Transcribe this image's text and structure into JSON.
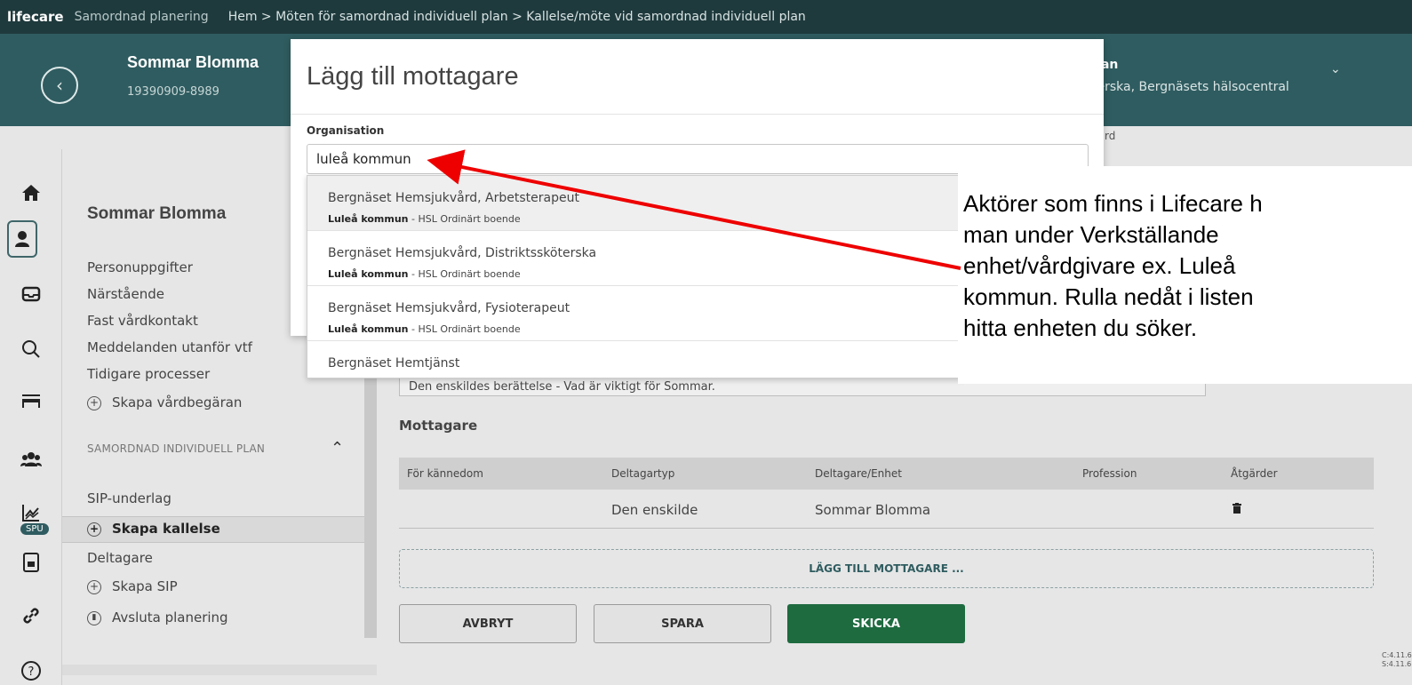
{
  "topbar": {
    "brand": "lifecare",
    "app_name": "Samordnad planering",
    "breadcrumb": "Hem > Möten för samordnad individuell plan > Kallelse/möte vid samordnad individuell plan"
  },
  "patient": {
    "name": "Sommar Blomma",
    "personal_number": "19390909-8989"
  },
  "user": {
    "name_fragment": "nan",
    "role_fragment": "terska, Bergnäsets hälsocentral"
  },
  "subheader_fragment": "rd",
  "rail": {
    "icons": [
      "home-icon",
      "patient-icon",
      "inbox-icon",
      "search-icon",
      "bed-icon",
      "group-icon",
      "chart-icon",
      "document-icon",
      "link-icon",
      "help-icon"
    ],
    "badge": "SPU"
  },
  "nav": {
    "title": "Sommar Blomma",
    "items": [
      "Personuppgifter",
      "Närstående",
      "Fast vårdkontakt",
      "Meddelanden utanför vtf",
      "Tidigare processer"
    ],
    "create_care_request": "Skapa vårdbegäran",
    "section_label": "SAMORDNAD INDIVIDUELL PLAN",
    "sip_basis": "SIP-underlag",
    "create_summons": "Skapa kallelse",
    "participants": "Deltagare",
    "create_sip": "Skapa SIP",
    "end_planning": "Avsluta planering"
  },
  "main": {
    "story_placeholder": "Den enskildes berättelse - Vad är viktigt för Sommar.",
    "recipients_label": "Mottagare",
    "table": {
      "headers": [
        "För kännedom",
        "Deltagartyp",
        "Deltagare/Enhet",
        "Profession",
        "Åtgärder"
      ],
      "rows": [
        {
          "fyi": "",
          "type": "Den enskilde",
          "participant": "Sommar Blomma",
          "profession": ""
        }
      ]
    },
    "add_recipient": "LÄGG TILL MOTTAGARE ...",
    "cancel": "AVBRYT",
    "save": "SPARA",
    "send": "SKICKA",
    "version_client": "C:4.11.6",
    "version_server": "S:4.11.6"
  },
  "modal": {
    "title": "Lägg till mottagare",
    "org_label": "Organisation",
    "org_value": "luleå kommun",
    "results": [
      {
        "name": "Bergnäset Hemsjukvård, Arbetsterapeut",
        "org": "Luleå kommun",
        "detail": " - HSL Ordinärt boende"
      },
      {
        "name": "Bergnäset Hemsjukvård, Distriktssköterska",
        "org": "Luleå kommun",
        "detail": " - HSL Ordinärt boende"
      },
      {
        "name": "Bergnäset Hemsjukvård, Fysioterapeut",
        "org": "Luleå kommun",
        "detail": " - HSL Ordinärt boende"
      },
      {
        "name": "Bergnäset Hemtjänst",
        "org": "",
        "detail": ""
      }
    ]
  },
  "annotation": {
    "text": "Aktörer som finns i Lifecare h\nman under Verkställande\nenhet/vårdgivare ex. Luleå\nkommun. Rulla nedåt i listen\nhitta enheten du söker.",
    "arrow_color": "#ee0000"
  }
}
